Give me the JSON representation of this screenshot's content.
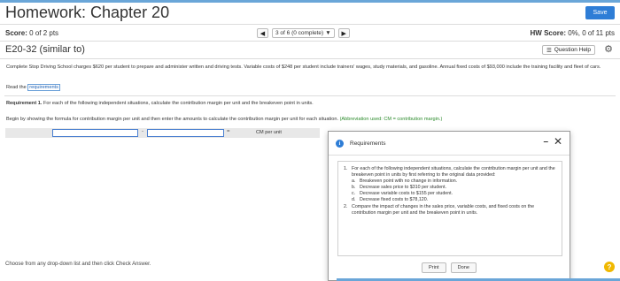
{
  "header": {
    "title": "Homework: Chapter 20",
    "save_label": "Save"
  },
  "scorebar": {
    "score_label": "Score:",
    "score_value": "0 of 2 pts",
    "question_select": "3 of 6 (0 complete)",
    "hw_score_label": "HW Score:",
    "hw_score_value": "0%, 0 of 11 pts"
  },
  "question": {
    "title": "E20-32 (similar to)",
    "help_label": "Question Help",
    "text": "Complete Stop Driving School charges $620 per student to prepare and administer written and driving tests. Variable costs of $248 per student include trainers' wages, study materials, and gasoline. Annual fixed costs of $93,000 include the training facility and fleet of cars.",
    "read_prefix": "Read the",
    "read_link": "requirements",
    "req1_label": "Requirement 1.",
    "req1_text": "For each of the following independent situations, calculate the contribution margin per unit and the breakeven point in units.",
    "begin_text": "Begin by showing the formula for contribution margin per unit and then enter the amounts to calculate the contribution margin per unit for each situation.",
    "begin_hint": "(Abbreviation used: CM = contribution margin.)",
    "minus_sign": "-",
    "equals_sign": "=",
    "cm_label": "CM per unit"
  },
  "footer": {
    "instruction": "Choose from any drop-down list and then click Check Answer.",
    "help_symbol": "?"
  },
  "dialog": {
    "title": "Requirements",
    "items": [
      {
        "num": "1.",
        "text": "For each of the following independent situations, calculate the contribution margin per unit and the breakeven point in units by first referring to the original data provided:",
        "subs": [
          {
            "letter": "a.",
            "text": "Breakeven point with no change in information."
          },
          {
            "letter": "b.",
            "text": "Decrease sales price to $310 per student."
          },
          {
            "letter": "c.",
            "text": "Decrease variable costs to $155 per student."
          },
          {
            "letter": "d.",
            "text": "Decrease fixed costs to $78,120."
          }
        ]
      },
      {
        "num": "2.",
        "text": "Compare the impact of changes in the sales price, variable costs, and fixed costs on the contribution margin per unit and the breakeven point in units.",
        "subs": []
      }
    ],
    "print_label": "Print",
    "done_label": "Done"
  },
  "colors": {
    "accent": "#2e7dd6",
    "topbar": "#6aa6d8",
    "hint_green": "#2a8a2a",
    "help_yellow": "#f0b800"
  }
}
